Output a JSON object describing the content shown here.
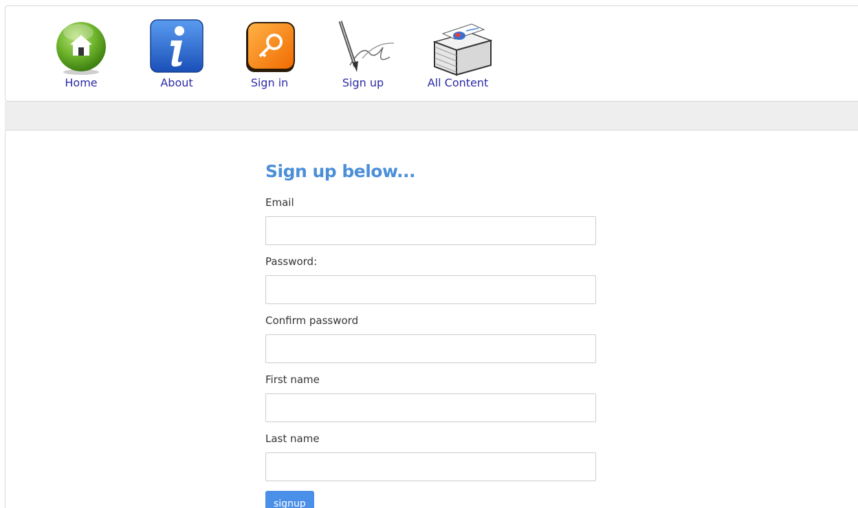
{
  "nav": {
    "items": [
      {
        "label": "Home",
        "icon": "home-icon"
      },
      {
        "label": "About",
        "icon": "info-icon"
      },
      {
        "label": "Sign in",
        "icon": "key-icon"
      },
      {
        "label": "Sign up",
        "icon": "pen-signature-icon"
      },
      {
        "label": "All Content",
        "icon": "documents-stack-icon"
      }
    ]
  },
  "form": {
    "title": "Sign up below...",
    "fields": [
      {
        "label": "Email",
        "value": "",
        "placeholder": ""
      },
      {
        "label": "Password:",
        "value": "",
        "placeholder": ""
      },
      {
        "label": "Confirm password",
        "value": "",
        "placeholder": ""
      },
      {
        "label": "First name",
        "value": "",
        "placeholder": ""
      },
      {
        "label": "Last name",
        "value": "",
        "placeholder": ""
      }
    ],
    "submit_label": "signup"
  },
  "colors": {
    "title": "#4a8fd8",
    "nav_link": "#2a2aa8",
    "button": "#4a8fe8"
  }
}
